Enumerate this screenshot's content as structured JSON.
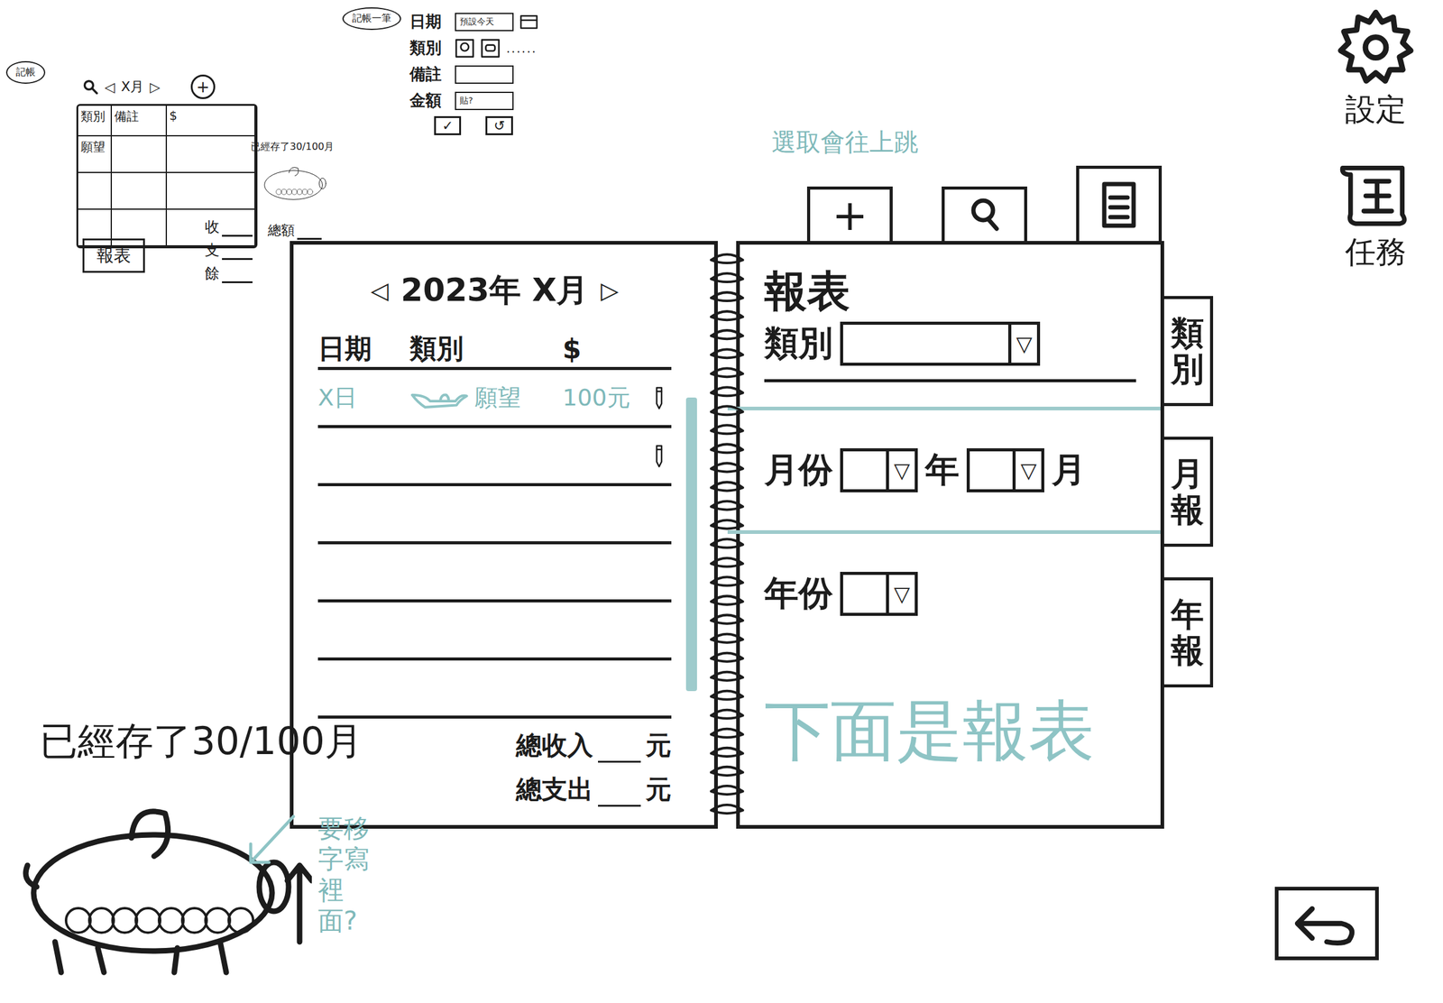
{
  "mini_list": {
    "badge": "記帳",
    "prev": "◁",
    "month": "X月",
    "next": "▷",
    "add": "+",
    "columns": [
      "類別",
      "備註",
      "$"
    ],
    "rows": [
      {
        "category": "願望"
      },
      {
        "category": ""
      },
      {
        "category": ""
      }
    ],
    "saved": "已經存了30/100月",
    "report_button": "報表",
    "summary": [
      "收",
      "支",
      "餘"
    ],
    "total_label": "總額"
  },
  "add_form": {
    "badge": "記帳一筆",
    "fields": [
      {
        "label": "日期",
        "value": "預設今天",
        "kind": "date"
      },
      {
        "label": "類別",
        "value": "",
        "kind": "category"
      },
      {
        "label": "備註",
        "value": "",
        "kind": "text"
      },
      {
        "label": "金額",
        "value": "貼?",
        "kind": "text"
      }
    ],
    "more": "......",
    "confirm": "✓",
    "cancel": "↺"
  },
  "side_menu": [
    {
      "label": "設定",
      "kind": "gear"
    },
    {
      "label": "任務",
      "kind": "scroll"
    }
  ],
  "notes": {
    "tabs_note": "選取會往上跳",
    "report_note": "下面是報表",
    "pig_note": "要移字寫裡面?"
  },
  "toolbar_tabs": [
    {
      "kind": "add",
      "label": "+"
    },
    {
      "kind": "search",
      "label": ""
    },
    {
      "kind": "list",
      "label": ""
    }
  ],
  "ledger": {
    "prev": "◁",
    "title": "2023年 X月",
    "next": "▷",
    "columns": [
      "日期",
      "類別",
      "$"
    ],
    "rows": [
      {
        "date": "X日",
        "category": "願望",
        "amount": "100元",
        "edit": true,
        "draft": true
      },
      {
        "date": "",
        "category": "",
        "amount": "",
        "edit": true,
        "draft": false
      },
      {
        "date": "",
        "category": "",
        "amount": "",
        "edit": false,
        "draft": false
      },
      {
        "date": "",
        "category": "",
        "amount": "",
        "edit": false,
        "draft": false
      },
      {
        "date": "",
        "category": "",
        "amount": "",
        "edit": false,
        "draft": false
      },
      {
        "date": "",
        "category": "",
        "amount": "",
        "edit": false,
        "draft": false
      }
    ],
    "totals": [
      {
        "label": "總收入",
        "unit": "元"
      },
      {
        "label": "總支出",
        "unit": "元"
      }
    ]
  },
  "report": {
    "title": "報表",
    "category_label": "類別",
    "month_label": "月份",
    "year_unit": "年",
    "month_unit": "月",
    "year_label": "年份",
    "dropdown": "▽"
  },
  "side_tabs": [
    "類別",
    "月報",
    "年報"
  ],
  "savings": {
    "text": "已經存了30/100月"
  }
}
